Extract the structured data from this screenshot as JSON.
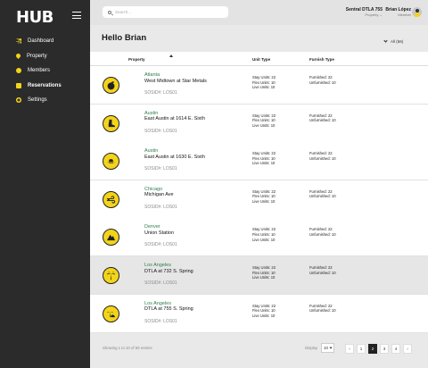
{
  "app": {
    "logo_text": "HUB"
  },
  "sidebar": {
    "items": [
      {
        "label": "Dashboard",
        "icon": "dashboard-icon",
        "active": false
      },
      {
        "label": "Property",
        "icon": "location-pin-icon",
        "active": false
      },
      {
        "label": "Members",
        "icon": "members-icon",
        "active": false
      },
      {
        "label": "Reservations",
        "icon": "calendar-icon",
        "active": true
      },
      {
        "label": "Settings",
        "icon": "gear-icon",
        "active": false
      }
    ]
  },
  "topbar": {
    "search_placeholder": "Search...",
    "property_name": "Sentral DTLA 755",
    "property_label": "Property",
    "user_name": "Brian López",
    "user_role": "Member"
  },
  "main": {
    "greeting": "Hello Brian",
    "filter_label": "All (56)",
    "columns": {
      "property": "Property",
      "unit_type": "Unit Type",
      "furnish_type": "Furnish Type"
    }
  },
  "rows": [
    {
      "city": "Atlanta",
      "name": "West Midtown at Star Metals",
      "sosid": "SOSID#: LOS01",
      "icon": "peach-icon",
      "stay": "Stay Units: 22",
      "flex": "Flex Units: 10",
      "live": "Live Units: 10",
      "furnished": "Furnished: 22",
      "unfurnished": "Unfurnished: 10",
      "highlight": false
    },
    {
      "city": "Austin",
      "name": "East Austin at 1614 E. Sixth",
      "sosid": "SOSID#: LOS01",
      "icon": "cowboy-boot-icon",
      "stay": "Stay Units: 22",
      "flex": "Flex Units: 10",
      "live": "Live Units: 10",
      "furnished": "Furnished: 22",
      "unfurnished": "Unfurnished: 10",
      "highlight": false
    },
    {
      "city": "Austin",
      "name": "East Austin at 1630 E. Sixth",
      "sosid": "SOSID#: LOS01",
      "icon": "cowboy-hat-icon",
      "stay": "Stay Units: 22",
      "flex": "Flex Units: 10",
      "live": "Live Units: 10",
      "furnished": "Furnished: 22",
      "unfurnished": "Unfurnished: 10",
      "highlight": false
    },
    {
      "city": "Chicago",
      "name": "Michigan Ave",
      "sosid": "SOSID#: LOS01",
      "icon": "wind-icon",
      "stay": "Stay Units: 22",
      "flex": "Flex Units: 10",
      "live": "Live Units: 10",
      "furnished": "Furnished: 22",
      "unfurnished": "Unfurnished: 10",
      "highlight": false
    },
    {
      "city": "Denver",
      "name": "Union Station",
      "sosid": "SOSID#: LOS01",
      "icon": "mountain-icon",
      "stay": "Stay Units: 22",
      "flex": "Flex Units: 10",
      "live": "Live Units: 10",
      "furnished": "Furnished: 22",
      "unfurnished": "Unfurnished: 10",
      "highlight": false
    },
    {
      "city": "Los Angeles",
      "name": "DTLA at 732 S. Spring",
      "sosid": "SOSID#: LOS01",
      "icon": "palm-tree-icon",
      "stay": "Stay Units: 22",
      "flex": "Flex Units: 10",
      "live": "Live Units: 10",
      "furnished": "Furnished: 22",
      "unfurnished": "Unfurnished: 10",
      "highlight": true
    },
    {
      "city": "Los Angeles",
      "name": "DTLA at 755 S. Spring",
      "sosid": "SOSID#: LOS01",
      "icon": "sunset-palm-icon",
      "stay": "Stay Units: 22",
      "flex": "Flex Units: 10",
      "live": "Live Units: 10",
      "furnished": "Furnished: 22",
      "unfurnished": "Unfurnished: 10",
      "highlight": false
    }
  ],
  "footer": {
    "showing": "Showing 1 to 10 of 50 entries",
    "display_label": "Display",
    "display_value": "10",
    "pages": [
      "1",
      "2",
      "3",
      "4"
    ],
    "current_page": "2",
    "prev": "‹",
    "next": "›"
  },
  "colors": {
    "accent": "#f3d41a",
    "sidebar": "#2b2b2b",
    "city": "#2e7d4f"
  }
}
